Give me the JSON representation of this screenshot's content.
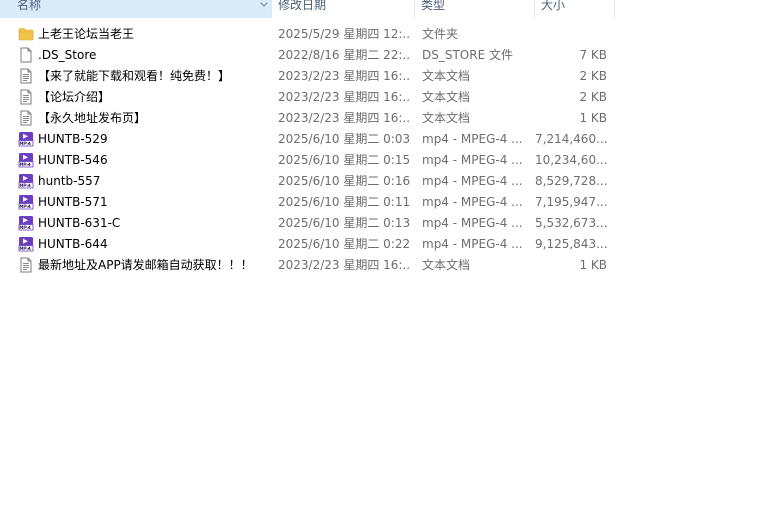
{
  "columns": {
    "name": "名称",
    "date": "修改日期",
    "type": "类型",
    "size": "大小"
  },
  "files": [
    {
      "icon": "folder-icon",
      "name": "上老王论坛当老王",
      "date": "2025/5/29 星期四 12:...",
      "type": "文件夹",
      "size": ""
    },
    {
      "icon": "blank-file-icon",
      "name": ".DS_Store",
      "date": "2022/8/16 星期二 22:...",
      "type": "DS_STORE 文件",
      "size": "7 KB"
    },
    {
      "icon": "text-file-icon",
      "name": "【来了就能下载和观看！纯免费！】",
      "date": "2023/2/23 星期四 16:...",
      "type": "文本文档",
      "size": "2 KB"
    },
    {
      "icon": "text-file-icon",
      "name": "【论坛介绍】",
      "date": "2023/2/23 星期四 16:...",
      "type": "文本文档",
      "size": "2 KB"
    },
    {
      "icon": "text-file-icon",
      "name": "【永久地址发布页】",
      "date": "2023/2/23 星期四 16:...",
      "type": "文本文档",
      "size": "1 KB"
    },
    {
      "icon": "mp4-video-icon",
      "name": "HUNTB-529",
      "date": "2025/6/10 星期二 0:03",
      "type": "mp4 - MPEG-4 ...",
      "size": "7,214,460..."
    },
    {
      "icon": "mp4-video-icon",
      "name": "HUNTB-546",
      "date": "2025/6/10 星期二 0:15",
      "type": "mp4 - MPEG-4 ...",
      "size": "10,234,60..."
    },
    {
      "icon": "mp4-video-icon",
      "name": "huntb-557",
      "date": "2025/6/10 星期二 0:16",
      "type": "mp4 - MPEG-4 ...",
      "size": "8,529,728..."
    },
    {
      "icon": "mp4-video-icon",
      "name": "HUNTB-571",
      "date": "2025/6/10 星期二 0:11",
      "type": "mp4 - MPEG-4 ...",
      "size": "7,195,947..."
    },
    {
      "icon": "mp4-video-icon",
      "name": "HUNTB-631-C",
      "date": "2025/6/10 星期二 0:13",
      "type": "mp4 - MPEG-4 ...",
      "size": "5,532,673..."
    },
    {
      "icon": "mp4-video-icon",
      "name": "HUNTB-644",
      "date": "2025/6/10 星期二 0:22",
      "type": "mp4 - MPEG-4 ...",
      "size": "9,125,843..."
    },
    {
      "icon": "text-file-icon",
      "name": "最新地址及APP请发邮箱自动获取！！！",
      "date": "2023/2/23 星期四 16:...",
      "type": "文本文档",
      "size": "1 KB"
    }
  ],
  "colors": {
    "sorted_header_bg": "#d9ebf9",
    "header_text": "#4c607a",
    "folder": "#f3c24b",
    "mp4_accent": "#6b3fc1"
  }
}
